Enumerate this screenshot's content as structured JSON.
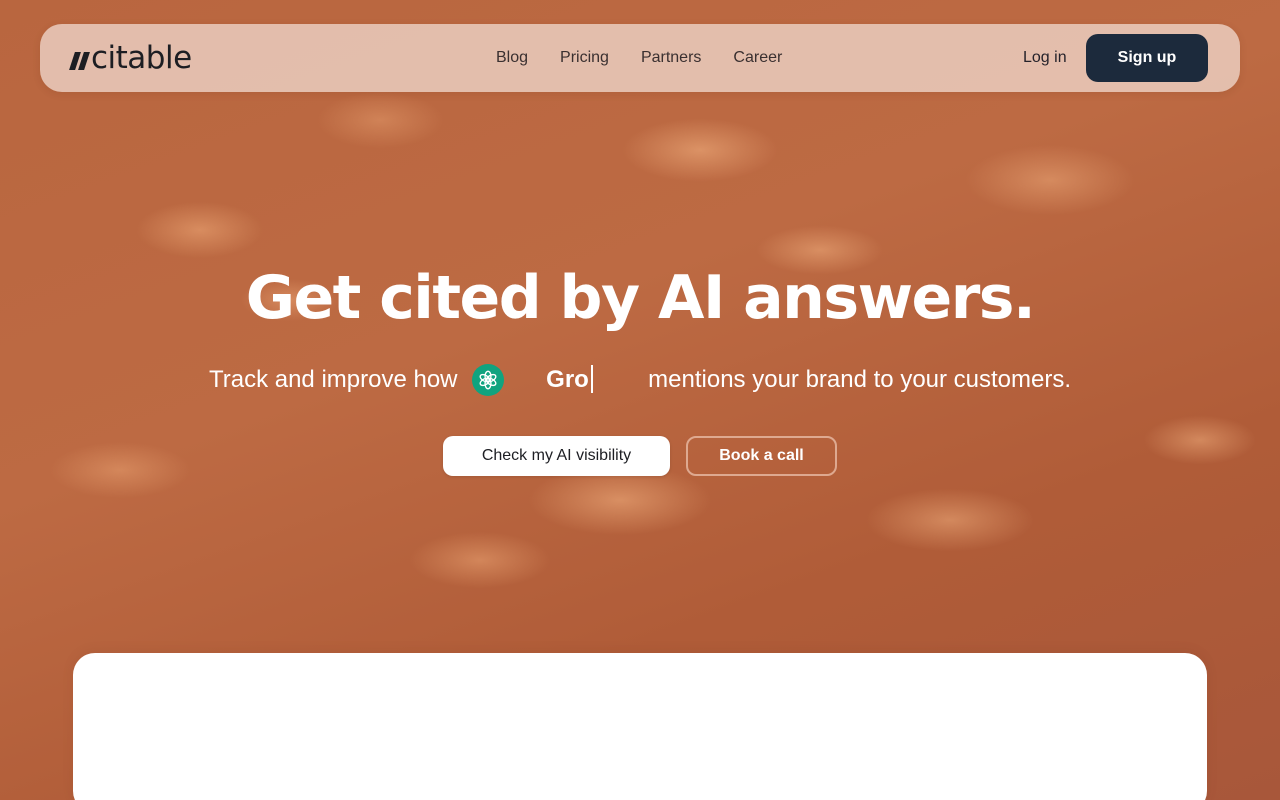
{
  "nav": {
    "logo_text": "citable",
    "links": [
      "Blog",
      "Pricing",
      "Partners",
      "Career"
    ],
    "login_label": "Log in",
    "signup_label": "Sign up"
  },
  "hero": {
    "title": "Get cited by AI answers.",
    "subtitle_before": "Track and improve how ",
    "subtitle_typed": "Gro",
    "subtitle_after": "mentions your brand to your customers.",
    "ai_icon": "chatgpt-icon",
    "primary_cta": "Check my AI visibility",
    "secondary_cta": "Book a call"
  },
  "colors": {
    "background": "#b5633f",
    "nav_background": "#eed6ca",
    "signup_background": "#1c2a3c",
    "ai_icon_background": "#10a37f"
  }
}
